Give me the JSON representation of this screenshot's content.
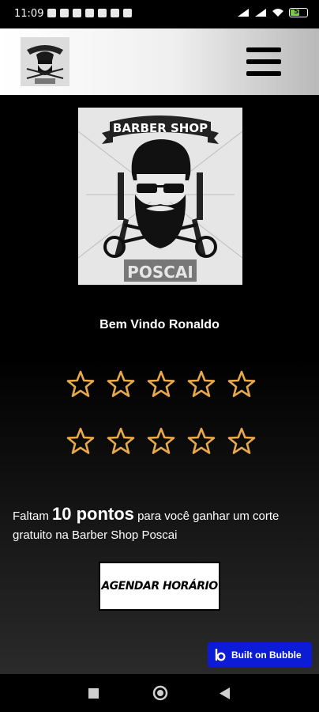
{
  "status_bar": {
    "time": "11:09",
    "battery": "58"
  },
  "header": {
    "logo_icon": "barber-shop-logo",
    "menu_icon": "hamburger-menu-icon"
  },
  "logo": {
    "banner_text": "BARBER SHOP",
    "name_text": "POSCAI"
  },
  "welcome": "Bem Vindo Ronaldo",
  "loyalty": {
    "stars_total": 10,
    "stars_filled": 0,
    "star_color": "#e8a94a",
    "prefix": "Faltam ",
    "points": "10 pontos",
    "suffix": " para você ganhar um corte gratuito na Barber Shop Poscai"
  },
  "cta": {
    "label": "AGENDAR HORÁRIO"
  },
  "bubble_badge": {
    "label": "Built on Bubble",
    "color": "#0b1bd6"
  },
  "nav": {
    "recents_icon": "square-icon",
    "home_icon": "circle-icon",
    "back_icon": "triangle-back-icon"
  }
}
